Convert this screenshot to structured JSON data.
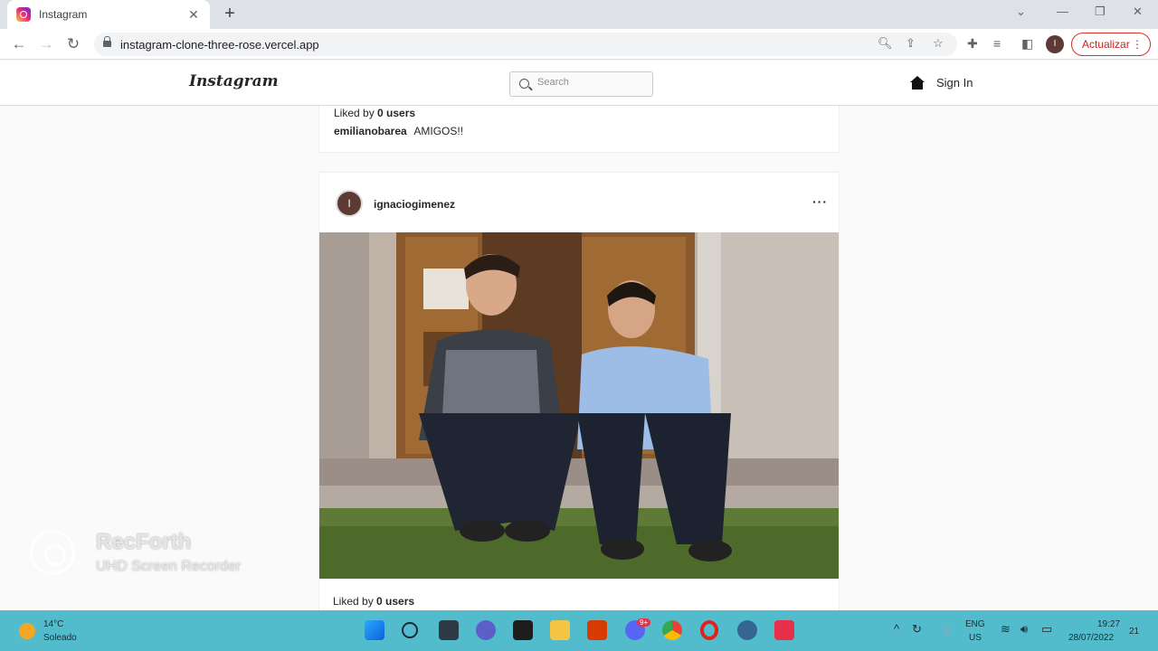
{
  "browser": {
    "tab_title": "Instagram",
    "tab_close": "✕",
    "new_tab": "+",
    "url": "instagram-clone-three-rose.vercel.app",
    "profile_initial": "I",
    "update_label": "Actualizar"
  },
  "header": {
    "logo": "Instagram",
    "search_placeholder": "Search",
    "sign_in": "Sign In"
  },
  "posts": [
    {
      "liked_prefix": "Liked by",
      "liked_count": "0 users",
      "caption_user": "emilianobarea",
      "caption_text": "AMIGOS!!"
    },
    {
      "avatar_initial": "I",
      "username": "ignaciogimenez",
      "liked_prefix": "Liked by",
      "liked_count": "0 users"
    }
  ],
  "watermark": {
    "name": "RecForth",
    "subtitle": "UHD Screen Recorder"
  },
  "taskbar": {
    "temperature": "14°C",
    "condition": "Soleado",
    "lang_top": "ENG",
    "lang_bottom": "US",
    "time": "19:27",
    "date": "28/07/2022",
    "notifications": "21",
    "discord_badge": "9+"
  }
}
